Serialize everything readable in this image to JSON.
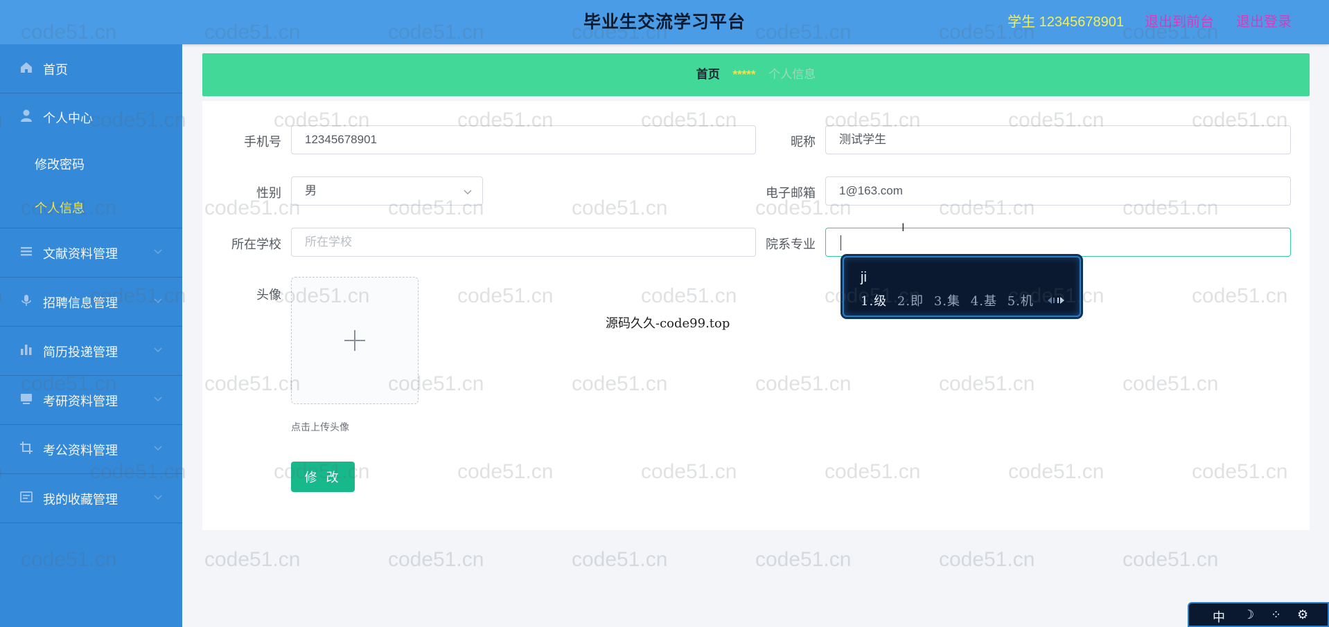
{
  "header": {
    "title": "毕业生交流学习平台",
    "user": "学生 12345678901",
    "frontend_link": "退出到前台",
    "logout_link": "退出登录"
  },
  "sidebar": {
    "home": "首页",
    "personal_center": "个人中心",
    "sub_items": [
      "修改密码",
      "个人信息"
    ],
    "menus": [
      "文献资料管理",
      "招聘信息管理",
      "简历投递管理",
      "考研资料管理",
      "考公资料管理",
      "我的收藏管理"
    ]
  },
  "breadcrumb": {
    "home": "首页",
    "separator": "*****",
    "current": "个人信息"
  },
  "form": {
    "phone_label": "手机号",
    "phone_value": "12345678901",
    "nickname_label": "昵称",
    "nickname_value": "测试学生",
    "gender_label": "性别",
    "gender_value": "男",
    "email_label": "电子邮箱",
    "email_value": "1@163.com",
    "school_label": "所在学校",
    "school_placeholder": "所在学校",
    "major_label": "院系专业",
    "major_value": "",
    "avatar_label": "头像",
    "upload_hint": "点击上传头像",
    "submit_label": "修 改"
  },
  "caption": "源码久久-code99.top",
  "ime": {
    "composition": "ji",
    "candidates": [
      "1.级",
      "2.即",
      "3.集",
      "4.基",
      "5.机"
    ],
    "toolbar": [
      "中",
      "☽",
      "⁘",
      "⚙"
    ]
  },
  "watermark": "code51.cn",
  "colors": {
    "header_bg": "#4a9ce6",
    "sidebar_bg": "#3489d8",
    "breadcrumb_bg": "#42d998",
    "button_bg": "#17b98a",
    "active_submenu": "#f2e94f",
    "header_link": "#d83ac0"
  }
}
